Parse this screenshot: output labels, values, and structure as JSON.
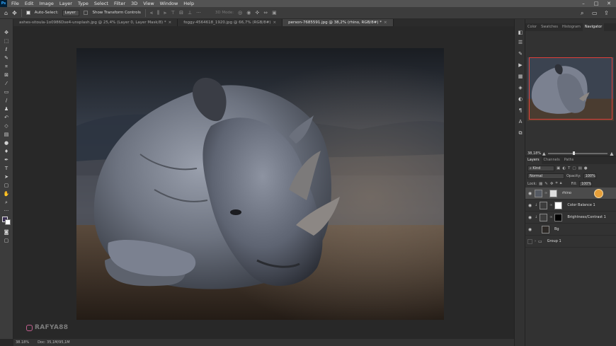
{
  "menubar": {
    "items": [
      "File",
      "Edit",
      "Image",
      "Layer",
      "Type",
      "Select",
      "Filter",
      "3D",
      "View",
      "Window",
      "Help"
    ],
    "app_logo": "Ps"
  },
  "options": {
    "auto_select_label": "Auto-Select:",
    "auto_select_value": "Layer",
    "transform_label": "Show Transform Controls",
    "mode_3d": "3D Mode:"
  },
  "tabs": [
    {
      "label": "ashes-sitoula-1o0986Dse4-unsplash.jpg @ 25,4% (Layer 0, Layer Mask/8) *"
    },
    {
      "label": "foggy-4564618_1920.jpg @ 66,7% (RGB/8#)"
    },
    {
      "label": "person-7685591.jpg @ 38,2% (rhino, RGB/8#) *"
    }
  ],
  "canvas": {
    "watermark_user": "RAFYA88"
  },
  "status": {
    "zoom": "38.18%",
    "doc": "Doc: 35,1M/95,1M"
  },
  "navigator": {
    "tabs": [
      "Color",
      "Swatches",
      "Histogram",
      "Navigator"
    ],
    "active_tab": 3,
    "zoom_value": "38,18%",
    "zoom_level": 0.42
  },
  "layers": {
    "tabs": [
      "Layers",
      "Channels",
      "Paths"
    ],
    "kind_label": "Kind",
    "blend_mode": "Normal",
    "opacity_label": "Opacity:",
    "opacity": "100%",
    "lock_label": "Lock:",
    "fill_label": "Fill:",
    "fill": "100%",
    "items": [
      {
        "name": "rhino",
        "type": "masked",
        "visible": true,
        "selected": true
      },
      {
        "name": "Color Balance 1",
        "type": "adjustment",
        "visible": true,
        "selected": false
      },
      {
        "name": "Brightness/Contrast 1",
        "type": "adjustment-dark-mask",
        "visible": true,
        "selected": false
      },
      {
        "name": "Bg",
        "type": "pixel",
        "visible": true,
        "selected": false
      },
      {
        "name": "Group 1",
        "type": "group",
        "visible": false,
        "selected": false
      }
    ]
  },
  "colors": {
    "selection_box": "#e0413a",
    "foreground": "#3a2f52",
    "background": "#ffffff",
    "cursor": "#e59f3a"
  }
}
